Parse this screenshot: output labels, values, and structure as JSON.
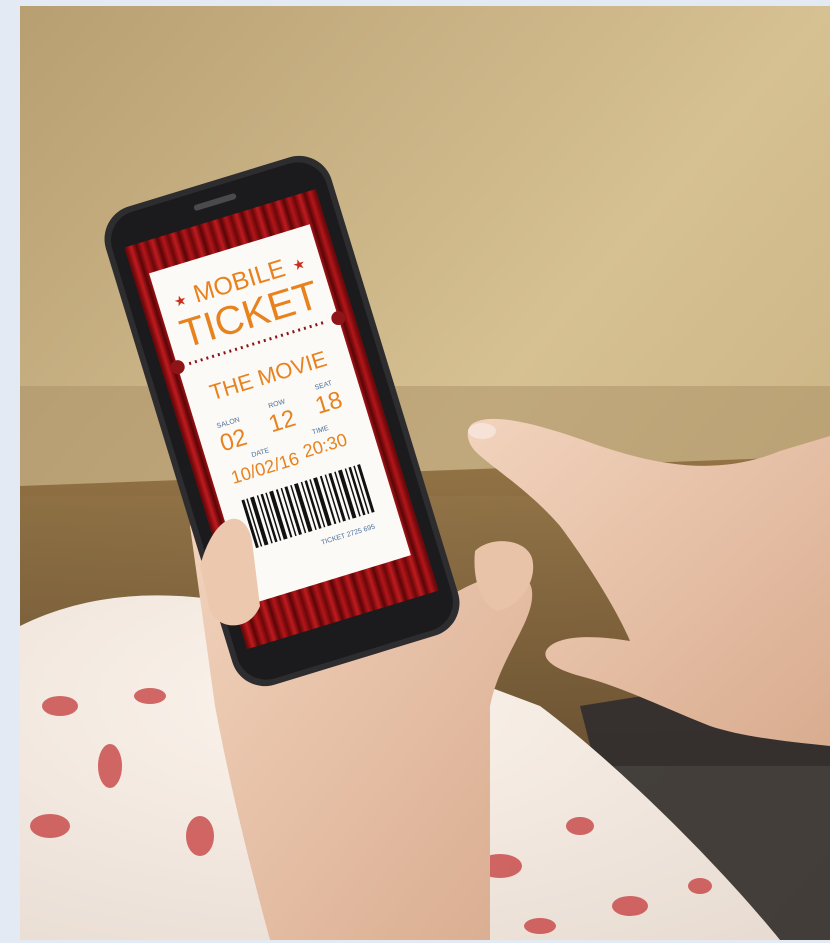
{
  "photo": {
    "subject": "hands-holding-smartphone-with-mobile-ticket",
    "ticket": {
      "header_line1": "MOBILE",
      "header_line2": "TICKET",
      "title": "THE MOVIE",
      "salon_label": "SALON",
      "salon_value": "02",
      "row_label": "ROW",
      "row_value": "12",
      "seat_label": "SEAT",
      "seat_value": "18",
      "date_label": "DATE",
      "date_value": "10/02/16",
      "time_label": "TIME",
      "time_value": "20:30",
      "ticket_number": "TICKET 2725 695"
    },
    "colors": {
      "frame_background": "#e4eaf4",
      "ticket_orange": "#e8821e",
      "ticket_blue": "#4a6f9a",
      "curtain_red": "#9a0f12",
      "wall_tan": "#c9b083"
    }
  }
}
